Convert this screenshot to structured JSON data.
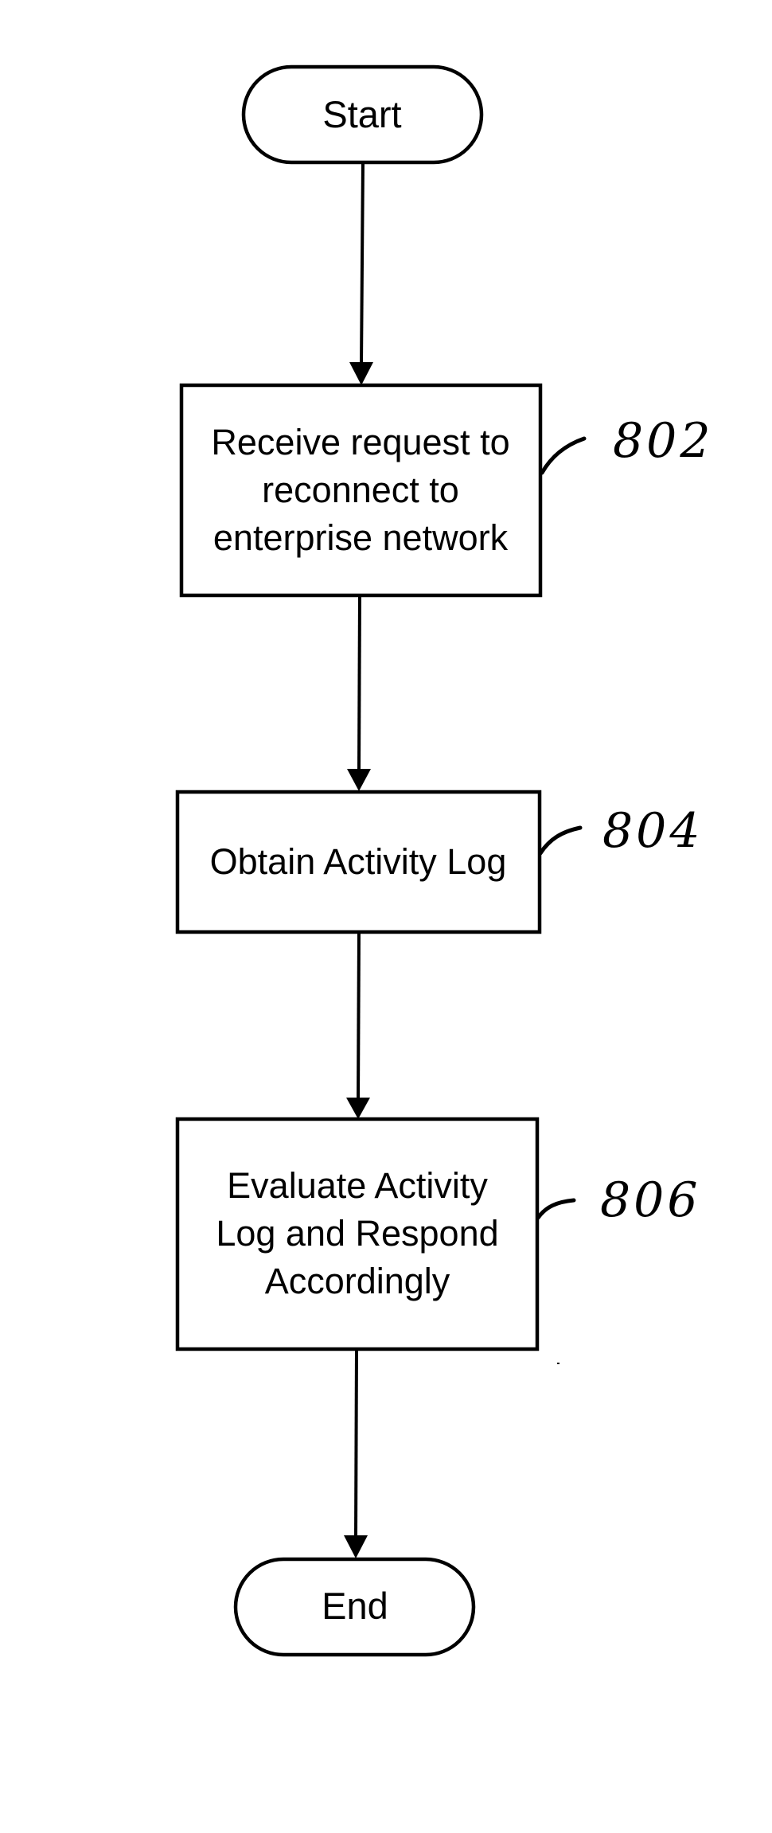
{
  "figure": {
    "type": "flowchart",
    "nodes": [
      {
        "id": "start",
        "shape": "terminator",
        "lines": [
          "Start"
        ]
      },
      {
        "id": "802",
        "shape": "process",
        "lines": [
          "Receive request to",
          "reconnect to",
          "enterprise network"
        ],
        "ref": "802"
      },
      {
        "id": "804",
        "shape": "process",
        "lines": [
          "Obtain Activity Log"
        ],
        "ref": "804"
      },
      {
        "id": "806",
        "shape": "process",
        "lines": [
          "Evaluate Activity",
          "Log and Respond",
          "Accordingly"
        ],
        "ref": "806"
      },
      {
        "id": "end",
        "shape": "terminator",
        "lines": [
          "End"
        ]
      }
    ],
    "edges": [
      {
        "from": "start",
        "to": "802"
      },
      {
        "from": "802",
        "to": "804"
      },
      {
        "from": "804",
        "to": "806"
      },
      {
        "from": "806",
        "to": "end"
      }
    ],
    "colors": {
      "stroke": "#000000",
      "fill": "#ffffff",
      "background": "#ffffff"
    }
  }
}
